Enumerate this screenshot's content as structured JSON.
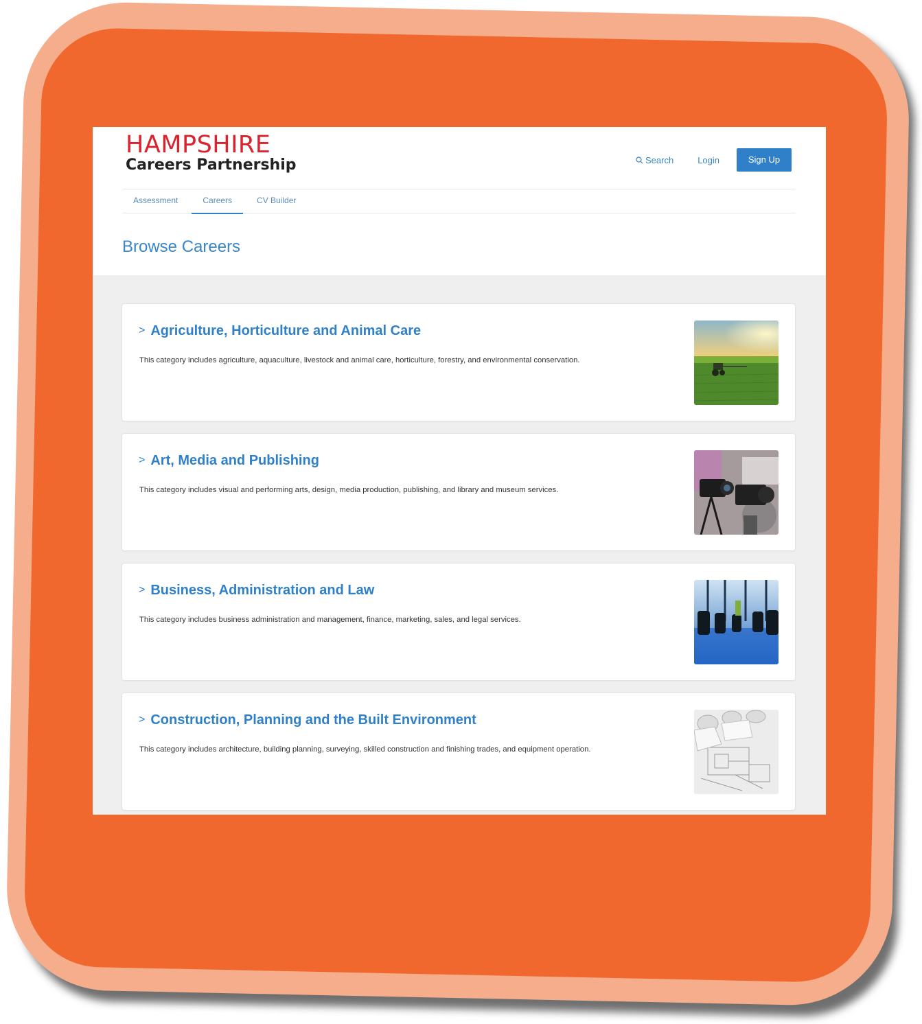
{
  "header": {
    "logo_top": "HAMPSHIRE",
    "logo_bottom": "Careers Partnership",
    "search_label": "Search",
    "login_label": "Login",
    "signup_label": "Sign Up"
  },
  "tabs": [
    {
      "label": "Assessment",
      "active": false
    },
    {
      "label": "Careers",
      "active": true
    },
    {
      "label": "CV Builder",
      "active": false
    }
  ],
  "page_title": "Browse Careers",
  "categories": [
    {
      "title": "Agriculture, Horticulture and Animal Care",
      "description": "This category includes agriculture, aquaculture, livestock and animal care, horticulture, forestry, and environmental conservation.",
      "image": "tractor-field-image"
    },
    {
      "title": "Art, Media and Publishing",
      "description": "This category includes visual and performing arts, design, media production, publishing, and library and museum services.",
      "image": "cameras-image"
    },
    {
      "title": "Business, Administration and Law",
      "description": "This category includes business administration and management, finance, marketing, sales, and legal services.",
      "image": "boardroom-image"
    },
    {
      "title": "Construction, Planning and the Built Environment",
      "description": "This category includes architecture, building planning, surveying, skilled construction and finishing trades, and equipment operation.",
      "image": "blueprints-image"
    }
  ],
  "colors": {
    "frame_outer": "#f5ad8c",
    "frame_inner": "#f0682e",
    "brand_red": "#d9232e",
    "link_blue": "#2f80c8"
  }
}
